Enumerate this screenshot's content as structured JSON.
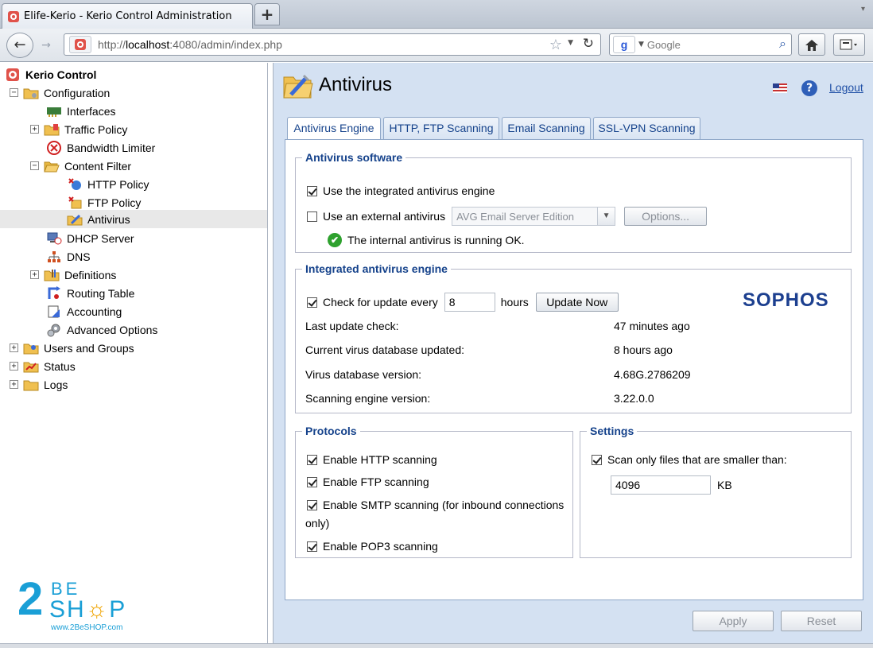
{
  "browser": {
    "tab_title": "Elife-Kerio - Kerio Control Administration",
    "new_tab": "+",
    "url_prefix": "http://",
    "url_host": "localhost",
    "url_rest": ":4080/admin/index.php",
    "search_engine": "Google"
  },
  "sidebar": {
    "root": "Kerio Control",
    "items": [
      {
        "label": "Configuration"
      },
      {
        "label": "Interfaces"
      },
      {
        "label": "Traffic Policy"
      },
      {
        "label": "Bandwidth Limiter"
      },
      {
        "label": "Content Filter"
      },
      {
        "label": "HTTP Policy"
      },
      {
        "label": "FTP Policy"
      },
      {
        "label": "Antivirus"
      },
      {
        "label": "DHCP Server"
      },
      {
        "label": "DNS"
      },
      {
        "label": "Definitions"
      },
      {
        "label": "Routing Table"
      },
      {
        "label": "Accounting"
      },
      {
        "label": "Advanced Options"
      },
      {
        "label": "Users and Groups"
      },
      {
        "label": "Status"
      },
      {
        "label": "Logs"
      }
    ],
    "logo": {
      "two": "2",
      "be": "BE",
      "shop_s": "SH",
      "shop_p": "P",
      "url": "www.2BeSHOP.com"
    }
  },
  "header": {
    "title": "Antivirus",
    "logout": "Logout"
  },
  "tabs": [
    {
      "label": "Antivirus Engine"
    },
    {
      "label": "HTTP, FTP Scanning"
    },
    {
      "label": "Email Scanning"
    },
    {
      "label": "SSL-VPN Scanning"
    }
  ],
  "antivirus_software": {
    "legend": "Antivirus software",
    "use_integrated": "Use the integrated antivirus engine",
    "use_integrated_checked": true,
    "use_external": "Use an external antivirus",
    "use_external_checked": false,
    "external_selected": "AVG Email Server Edition",
    "options_button": "Options...",
    "status": "The internal antivirus is running OK."
  },
  "engine": {
    "legend": "Integrated antivirus engine",
    "check_label": "Check for update every",
    "check_checked": true,
    "hours_value": "8",
    "hours_label": "hours",
    "update_button": "Update Now",
    "brand": "SOPHOS",
    "info": [
      {
        "label": "Last update check:",
        "value": "47 minutes ago"
      },
      {
        "label": "Current virus database updated:",
        "value": "8 hours ago"
      },
      {
        "label": "Virus database version:",
        "value": "4.68G.2786209"
      },
      {
        "label": "Scanning engine version:",
        "value": "3.22.0.0"
      }
    ]
  },
  "protocols": {
    "legend": "Protocols",
    "http": "Enable HTTP scanning",
    "ftp": "Enable FTP scanning",
    "smtp_line1": "Enable SMTP scanning (for inbound connections",
    "smtp_line2": "only)",
    "pop3": "Enable POP3 scanning"
  },
  "settings": {
    "legend": "Settings",
    "scan_only": "Scan only files that are smaller than:",
    "size_value": "4096",
    "unit": "KB"
  },
  "footer": {
    "apply": "Apply",
    "reset": "Reset"
  }
}
